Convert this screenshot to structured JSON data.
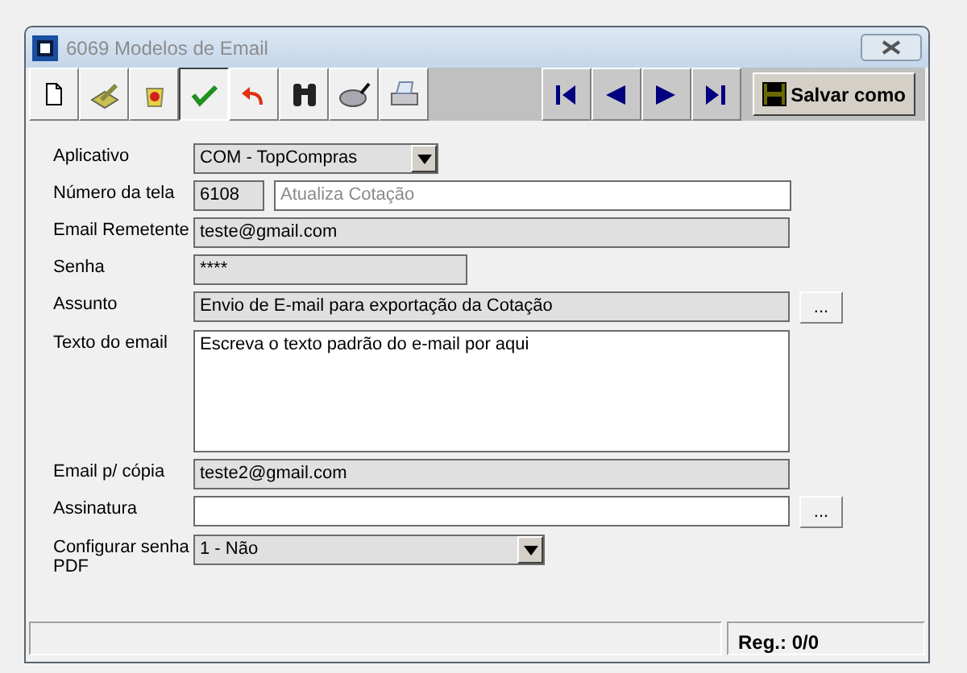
{
  "window": {
    "title": "6069 Modelos de Email"
  },
  "toolbar": [
    {
      "kind": "new",
      "pressed": false
    },
    {
      "kind": "edit",
      "pressed": false
    },
    {
      "kind": "delete",
      "pressed": false
    },
    {
      "kind": "confirm",
      "pressed": true
    },
    {
      "kind": "undo",
      "pressed": false
    },
    {
      "kind": "find",
      "pressed": false
    },
    {
      "kind": "search",
      "pressed": false
    },
    {
      "kind": "print",
      "pressed": false
    }
  ],
  "navigation": [
    {
      "kind": "first"
    },
    {
      "kind": "previous"
    },
    {
      "kind": "next"
    },
    {
      "kind": "last"
    }
  ],
  "save_as_button": "Salvar como",
  "fields": [
    {
      "label": "Aplicativo",
      "kind": "combo",
      "value": "COM - TopCompras"
    },
    {
      "label": "Número da tela",
      "kind": "pair",
      "value": "6108",
      "readonly": true,
      "description": "Atualiza Cotação"
    },
    {
      "label": "Email Remetente",
      "kind": "text",
      "value": "teste@gmail.com",
      "readonly": true
    },
    {
      "label": "Senha",
      "kind": "text",
      "value": "****",
      "readonly": true
    },
    {
      "label": "Assunto",
      "kind": "text",
      "value": "Envio de E-mail para exportação da Cotação",
      "readonly": true,
      "button": "..."
    },
    {
      "label": "Texto do email",
      "kind": "textarea",
      "value": "Escreva o texto padrão do e-mail por aqui",
      "readonly": false
    },
    {
      "label": "Email p/ cópia",
      "kind": "text",
      "value": "teste2@gmail.com",
      "readonly": true
    },
    {
      "label": "Assinatura",
      "kind": "text",
      "readonly": false,
      "button": "..."
    },
    {
      "label": "Configurar senha PDF",
      "kind": "combo",
      "value": "1 - Não"
    }
  ],
  "status_bar": {
    "record": "Reg.: 0/0"
  }
}
